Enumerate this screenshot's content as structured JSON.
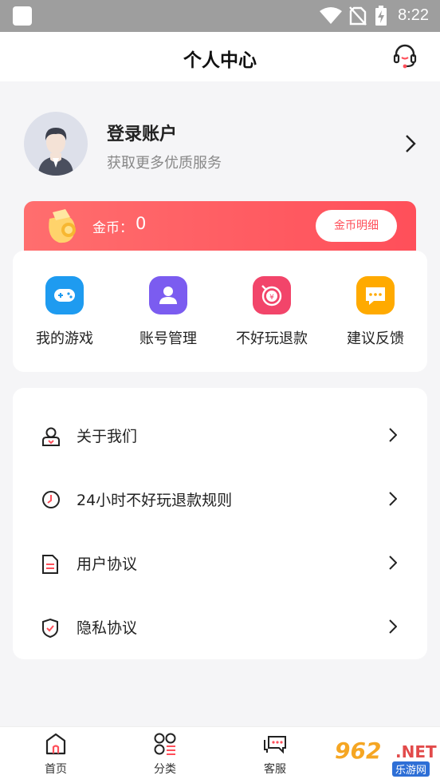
{
  "status_bar": {
    "time": "8:22"
  },
  "header": {
    "title": "个人中心",
    "cs_icon": "headset-icon"
  },
  "profile": {
    "title": "登录账户",
    "subtitle": "获取更多优质服务"
  },
  "coins": {
    "label": "金币：",
    "value": "0",
    "detail_button": "金币明细"
  },
  "quick_actions": [
    {
      "label": "我的游戏",
      "icon": "gamepad-icon",
      "color": "#1e9bf0"
    },
    {
      "label": "账号管理",
      "icon": "user-icon",
      "color": "#7b5cf0"
    },
    {
      "label": "不好玩退款",
      "icon": "refund-icon",
      "color": "#f2456a"
    },
    {
      "label": "建议反馈",
      "icon": "message-icon",
      "color": "#ffaa00"
    }
  ],
  "menu": [
    {
      "label": "关于我们",
      "icon": "about-user-icon"
    },
    {
      "label": "24小时不好玩退款规则",
      "icon": "clock-icon"
    },
    {
      "label": "用户协议",
      "icon": "document-icon"
    },
    {
      "label": "隐私协议",
      "icon": "shield-check-icon"
    }
  ],
  "tabs": [
    {
      "label": "首页",
      "icon": "home-icon"
    },
    {
      "label": "分类",
      "icon": "category-icon"
    },
    {
      "label": "客服",
      "icon": "chat-icon"
    }
  ],
  "watermark": {
    "number": "962",
    "suffix": ".NET",
    "site": "乐游网"
  },
  "colors": {
    "accent": "#ff4f5a",
    "background": "#f5f5f7"
  }
}
